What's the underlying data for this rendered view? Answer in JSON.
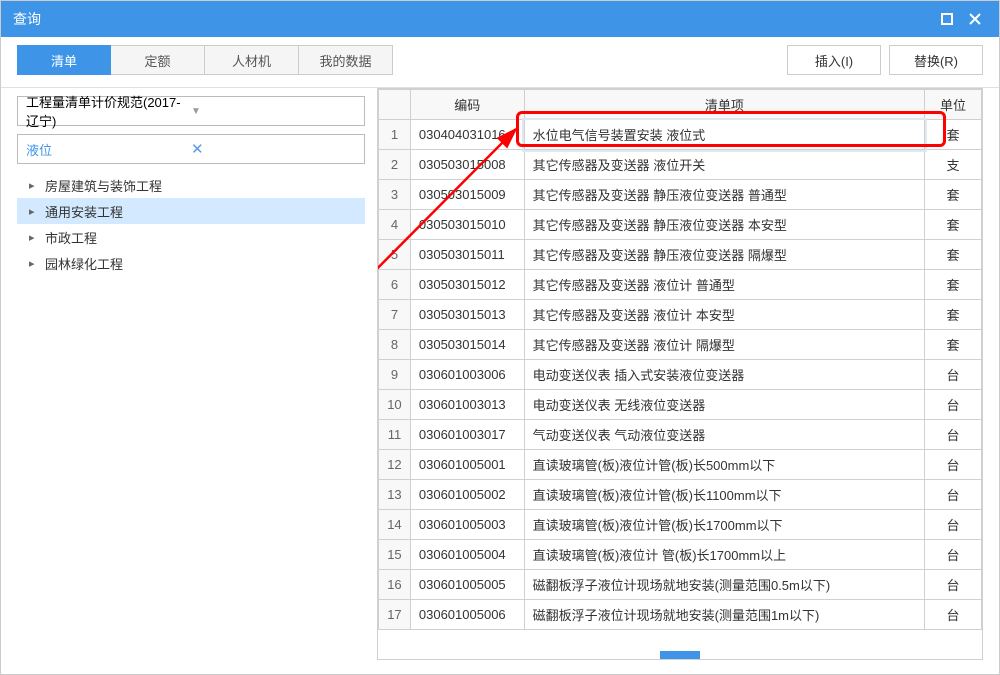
{
  "window": {
    "title": "查询"
  },
  "toolbar": {
    "tabs": [
      {
        "label": "清单",
        "active": true
      },
      {
        "label": "定额",
        "active": false
      },
      {
        "label": "人材机",
        "active": false
      },
      {
        "label": "我的数据",
        "active": false
      }
    ],
    "insert_label": "插入(I)",
    "replace_label": "替换(R)"
  },
  "left": {
    "dropdown": "工程量清单计价规范(2017-辽宁)",
    "search_value": "液位",
    "tree": [
      {
        "label": "房屋建筑与装饰工程",
        "selected": false
      },
      {
        "label": "通用安装工程",
        "selected": true
      },
      {
        "label": "市政工程",
        "selected": false
      },
      {
        "label": "园林绿化工程",
        "selected": false
      }
    ]
  },
  "grid": {
    "headers": {
      "code": "编码",
      "desc": "清单项",
      "unit": "单位"
    },
    "rows": [
      {
        "n": "1",
        "code": "030404031016",
        "desc": "水位电气信号装置安装 液位式",
        "unit": "套",
        "selected": true
      },
      {
        "n": "2",
        "code": "030503015008",
        "desc": "其它传感器及变送器 液位开关",
        "unit": "支"
      },
      {
        "n": "3",
        "code": "030503015009",
        "desc": "其它传感器及变送器 静压液位变送器 普通型",
        "unit": "套"
      },
      {
        "n": "4",
        "code": "030503015010",
        "desc": "其它传感器及变送器 静压液位变送器 本安型",
        "unit": "套"
      },
      {
        "n": "5",
        "code": "030503015011",
        "desc": "其它传感器及变送器 静压液位变送器 隔爆型",
        "unit": "套"
      },
      {
        "n": "6",
        "code": "030503015012",
        "desc": "其它传感器及变送器 液位计 普通型",
        "unit": "套"
      },
      {
        "n": "7",
        "code": "030503015013",
        "desc": "其它传感器及变送器 液位计 本安型",
        "unit": "套"
      },
      {
        "n": "8",
        "code": "030503015014",
        "desc": "其它传感器及变送器 液位计 隔爆型",
        "unit": "套"
      },
      {
        "n": "9",
        "code": "030601003006",
        "desc": "电动变送仪表 插入式安装液位变送器",
        "unit": "台"
      },
      {
        "n": "10",
        "code": "030601003013",
        "desc": "电动变送仪表 无线液位变送器",
        "unit": "台"
      },
      {
        "n": "11",
        "code": "030601003017",
        "desc": "气动变送仪表 气动液位变送器",
        "unit": "台"
      },
      {
        "n": "12",
        "code": "030601005001",
        "desc": "直读玻璃管(板)液位计管(板)长500mm以下",
        "unit": "台"
      },
      {
        "n": "13",
        "code": "030601005002",
        "desc": "直读玻璃管(板)液位计管(板)长1100mm以下",
        "unit": "台"
      },
      {
        "n": "14",
        "code": "030601005003",
        "desc": "直读玻璃管(板)液位计管(板)长1700mm以下",
        "unit": "台"
      },
      {
        "n": "15",
        "code": "030601005004",
        "desc": "直读玻璃管(板)液位计 管(板)长1700mm以上",
        "unit": "台"
      },
      {
        "n": "16",
        "code": "030601005005",
        "desc": "磁翻板浮子液位计现场就地安装(测量范围0.5m以下)",
        "unit": "台"
      },
      {
        "n": "17",
        "code": "030601005006",
        "desc": "磁翻板浮子液位计现场就地安装(测量范围1m以下)",
        "unit": "台"
      }
    ]
  }
}
